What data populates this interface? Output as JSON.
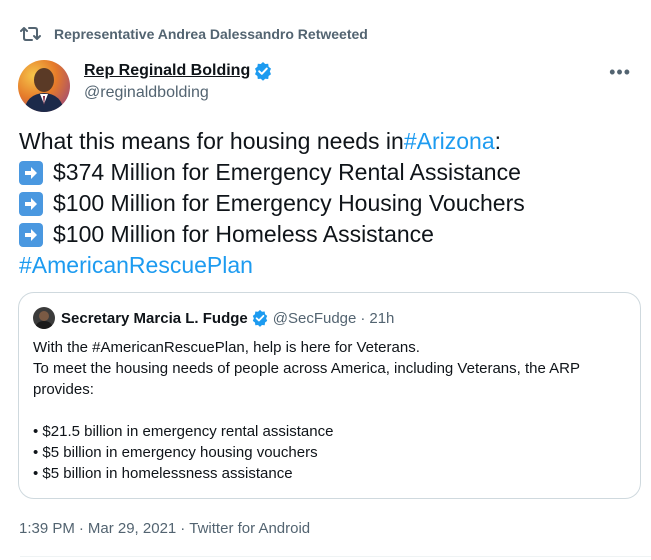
{
  "retweet": {
    "icon": "retweet-icon",
    "text": "Representative Andrea Dalessandro Retweeted"
  },
  "author": {
    "name": "Rep Reginald Bolding",
    "handle": "@reginaldbolding",
    "verified": true
  },
  "more_label": "•••",
  "body": {
    "line1_prefix": "What this means for housing needs in ",
    "line1_hashtag": "#Arizona",
    "line1_suffix": ":",
    "items": [
      "$374 Million for Emergency Rental Assistance",
      "$100 Million for Emergency Housing Vouchers",
      "$100 Million for Homeless Assistance"
    ],
    "hashtag2": "#AmericanRescuePlan"
  },
  "quote": {
    "name": "Secretary Marcia L. Fudge",
    "handle": "@SecFudge",
    "dot": "·",
    "time": "21h",
    "lines": [
      "With the #AmericanRescuePlan, help is here for Veterans.",
      "To meet the housing needs of people across America, including Veterans, the ARP",
      "provides:"
    ],
    "bullets": [
      "• $21.5 billion in emergency rental assistance",
      "• $5 billion in emergency housing vouchers",
      "• $5 billion in homelessness assistance"
    ]
  },
  "meta": {
    "time": "1:39 PM",
    "sep": "·",
    "date": "Mar 29, 2021",
    "source": "Twitter for Android"
  },
  "colors": {
    "link": "#1d9bf0",
    "secondary": "#536471",
    "arrow_box": "#4a98e0",
    "border": "#cfd9de"
  }
}
